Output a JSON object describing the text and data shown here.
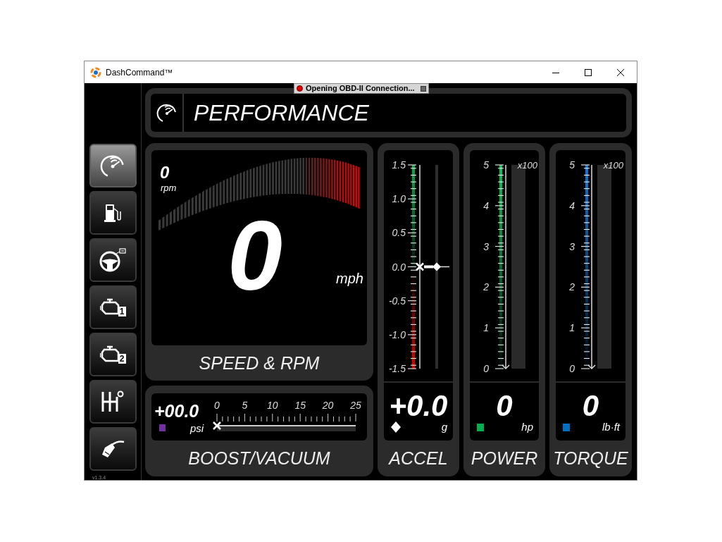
{
  "window": {
    "title": "DashCommand™"
  },
  "status_popup": {
    "text": "Opening OBD-II Connection..."
  },
  "sidebar": {
    "items": [
      {
        "kind": "gauge",
        "selected": true
      },
      {
        "kind": "fuel",
        "selected": false
      },
      {
        "kind": "wheel",
        "selected": false
      },
      {
        "kind": "engine",
        "badge": "1",
        "selected": false
      },
      {
        "kind": "engine",
        "badge": "2",
        "selected": false
      },
      {
        "kind": "shifter",
        "selected": false
      },
      {
        "kind": "nozzle",
        "selected": false
      }
    ],
    "version": "v1.3.4"
  },
  "header": {
    "title": "PERFORMANCE"
  },
  "speed_panel": {
    "title": "SPEED & RPM",
    "rpm": "0",
    "rpm_unit": "rpm",
    "speed": "0",
    "speed_unit": "mph"
  },
  "boost_panel": {
    "title": "BOOST/VACUUM",
    "reading": "+00.0",
    "unit": "psi",
    "color": "#7030a0",
    "ticks": [
      "0",
      "5",
      "10",
      "15",
      "20",
      "25"
    ],
    "level": 0
  },
  "meters": [
    {
      "kind": "accel",
      "title": "ACCEL",
      "ticks": [
        "1.5",
        "1.0",
        "0.5",
        "0.0",
        "-0.5",
        "-1.0",
        "-1.5"
      ],
      "level": 0.5,
      "reading": "+0.0",
      "unit": "g"
    },
    {
      "kind": "power",
      "title": "POWER",
      "ticks": [
        "5",
        "4",
        "3",
        "2",
        "1",
        "0"
      ],
      "multiplier": "x100",
      "level": 0,
      "reading": "0",
      "unit": "hp",
      "color": "#00b050"
    },
    {
      "kind": "torque",
      "title": "TORQUE",
      "ticks": [
        "5",
        "4",
        "3",
        "2",
        "1",
        "0"
      ],
      "multiplier": "x100",
      "level": 0,
      "reading": "0",
      "unit": "lb·ft",
      "color": "#0070c0"
    }
  ]
}
